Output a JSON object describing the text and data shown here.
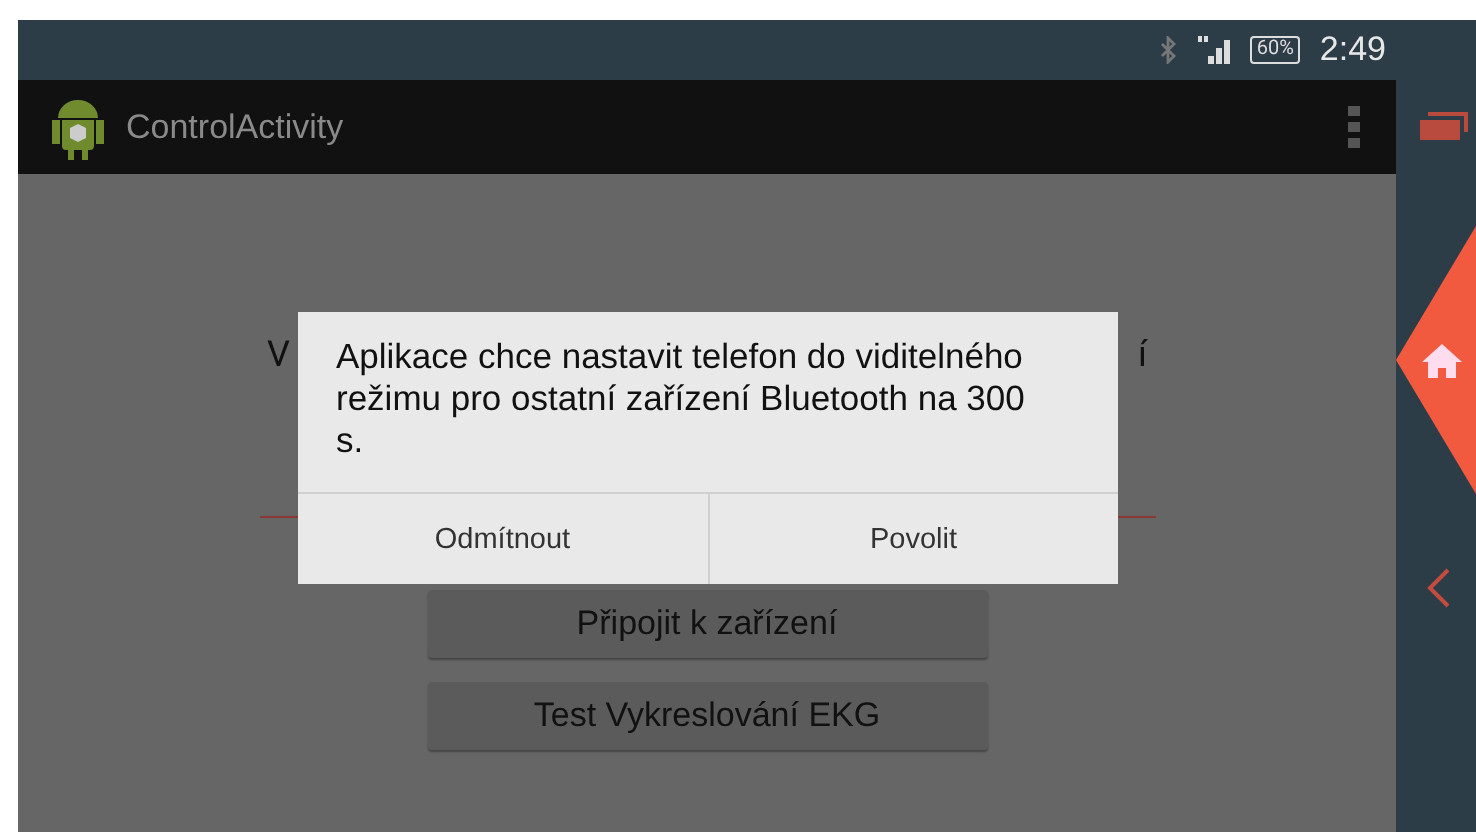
{
  "status_bar": {
    "battery": "60%",
    "time": "2:49"
  },
  "action_bar": {
    "title": "ControlActivity"
  },
  "content": {
    "text_left": "V",
    "text_right": "í",
    "buttons": [
      "Připojit k zařízení",
      "Test Vykreslování EKG"
    ]
  },
  "dialog": {
    "message": "Aplikace chce nastavit telefon do viditelného režimu pro ostatní zařízení Bluetooth na 300 s.",
    "buttons": [
      "Odmítnout",
      "Povolit"
    ]
  }
}
